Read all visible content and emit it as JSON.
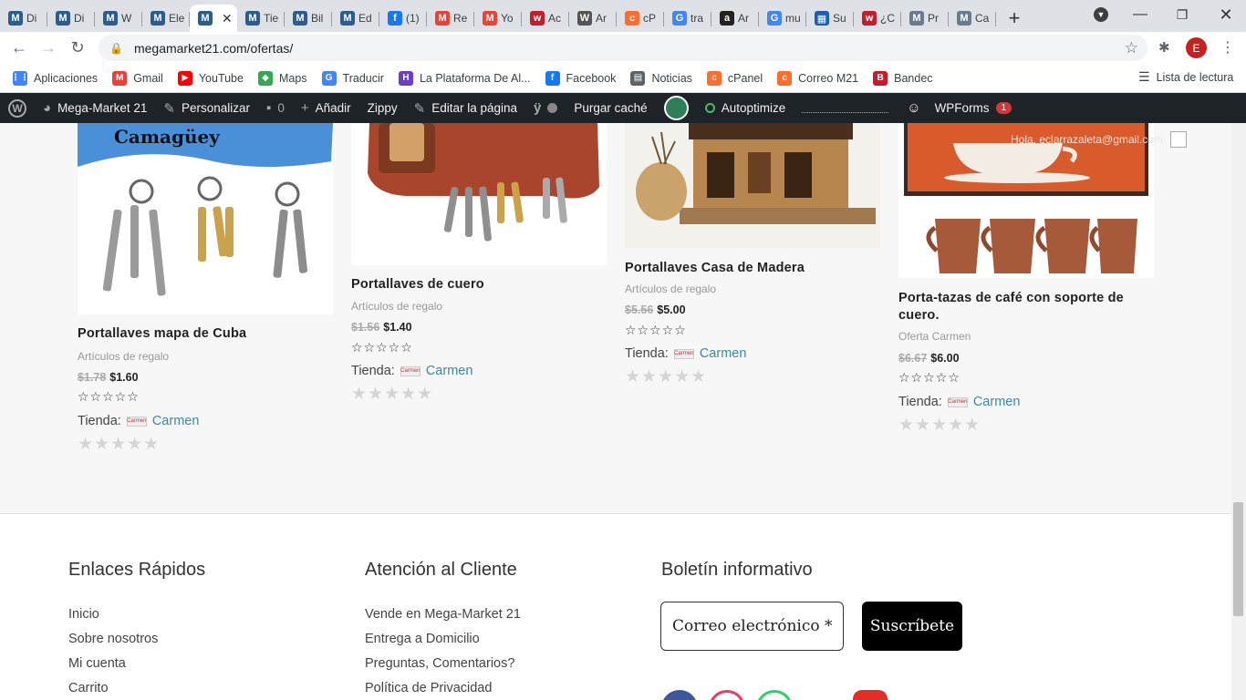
{
  "tabs": [
    {
      "label": "Di",
      "icon": "M",
      "color": "#2d5c8e"
    },
    {
      "label": "Di",
      "icon": "M",
      "color": "#2d5c8e"
    },
    {
      "label": "W",
      "icon": "M",
      "color": "#2d5c8e"
    },
    {
      "label": "Ele",
      "icon": "M",
      "color": "#2d5c8e"
    },
    {
      "label": "",
      "icon": "M",
      "color": "#2d5c8e",
      "active": true
    },
    {
      "label": "Tie",
      "icon": "M",
      "color": "#2d5c8e"
    },
    {
      "label": "Bil",
      "icon": "M",
      "color": "#2d5c8e"
    },
    {
      "label": "Ed",
      "icon": "M",
      "color": "#2d5c8e"
    },
    {
      "label": "(1)",
      "icon": "f",
      "color": "#1877f2"
    },
    {
      "label": "Re",
      "icon": "M",
      "color": "#ea4335"
    },
    {
      "label": "Yo",
      "icon": "M",
      "color": "#ea4335"
    },
    {
      "label": "Ac",
      "icon": "w",
      "color": "#c21e2b"
    },
    {
      "label": "Ar",
      "icon": "W",
      "color": "#555"
    },
    {
      "label": "cP",
      "icon": "c",
      "color": "#ff6c2c"
    },
    {
      "label": "tra",
      "icon": "G",
      "color": "#4285f4"
    },
    {
      "label": "Ar",
      "icon": "a",
      "color": "#222"
    },
    {
      "label": "mu",
      "icon": "G",
      "color": "#4285f4"
    },
    {
      "label": "Su",
      "icon": "▦",
      "color": "#1a5fb4"
    },
    {
      "label": "¿C",
      "icon": "w",
      "color": "#c21e2b"
    },
    {
      "label": "Pr",
      "icon": "M",
      "color": "#6b7a8f"
    },
    {
      "label": "Ca",
      "icon": "M",
      "color": "#6b7a8f"
    }
  ],
  "browser": {
    "url": "megamarket21.com/ofertas/",
    "profile_initial": "E"
  },
  "bookmarks": [
    {
      "label": "Aplicaciones",
      "icon": "apps-icon",
      "color": "#4285f4"
    },
    {
      "label": "Gmail",
      "icon": "gmail-icon",
      "color": "#ea4335"
    },
    {
      "label": "YouTube",
      "icon": "youtube-icon",
      "color": "#ff0000"
    },
    {
      "label": "Maps",
      "icon": "maps-icon",
      "color": "#34a853"
    },
    {
      "label": "Traducir",
      "icon": "translate-icon",
      "color": "#4285f4"
    },
    {
      "label": "La Plataforma De Al...",
      "icon": "platform-icon",
      "color": "#6a3fc1"
    },
    {
      "label": "Facebook",
      "icon": "facebook-icon",
      "color": "#1877f2"
    },
    {
      "label": "Noticias",
      "icon": "news-icon",
      "color": "#5f6368"
    },
    {
      "label": "cPanel",
      "icon": "cpanel-icon",
      "color": "#ff6c2c"
    },
    {
      "label": "Correo M21",
      "icon": "cpanel-icon",
      "color": "#ff6c2c"
    },
    {
      "label": "Bandec",
      "icon": "bandec-icon",
      "color": "#c21e2b"
    }
  ],
  "reading_list": "Lista de lectura",
  "adminbar": {
    "site": "Mega-Market 21",
    "customize": "Personalizar",
    "comments": "0",
    "add": "Añadir",
    "zippy": "Zippy",
    "edit_page": "Editar la página",
    "purge": "Purgar caché",
    "autoptimize": "Autoptimize",
    "wpforms": "WPForms",
    "wpforms_count": "1",
    "greeting": "Hola, eclarrazaleta@gmail.com"
  },
  "products": [
    {
      "name": "Portallaves mapa de Cuba",
      "category": "Artículos de regalo",
      "old_price": "$1.78",
      "price": "$1.60",
      "store_label": "Tienda:",
      "store": "Carmen"
    },
    {
      "name": "Portallaves de cuero",
      "category": "Artículos de regalo",
      "old_price": "$1.56",
      "price": "$1.40",
      "store_label": "Tienda:",
      "store": "Carmen"
    },
    {
      "name": "Portallaves Casa de Madera",
      "category": "Artículos de regalo",
      "old_price": "$5.56",
      "price": "$5.00",
      "store_label": "Tienda:",
      "store": "Carmen"
    },
    {
      "name": "Porta-tazas de café con soporte de cuero.",
      "category": "Oferta Carmen",
      "old_price": "$6.67",
      "price": "$6.00",
      "store_label": "Tienda:",
      "store": "Carmen"
    }
  ],
  "footer": {
    "col1_title": "Enlaces Rápidos",
    "col1_links": [
      "Inicio",
      "Sobre nosotros",
      "Mi cuenta",
      "Carrito"
    ],
    "col2_title": "Atención al Cliente",
    "col2_links": [
      "Vende en Mega-Market 21",
      "Entrega a Domicilio",
      "Preguntas, Comentarios?",
      "Política de Privacidad"
    ],
    "col3_title": "Boletín informativo",
    "email_placeholder": "Correo electrónico *",
    "subscribe": "Suscríbete"
  }
}
